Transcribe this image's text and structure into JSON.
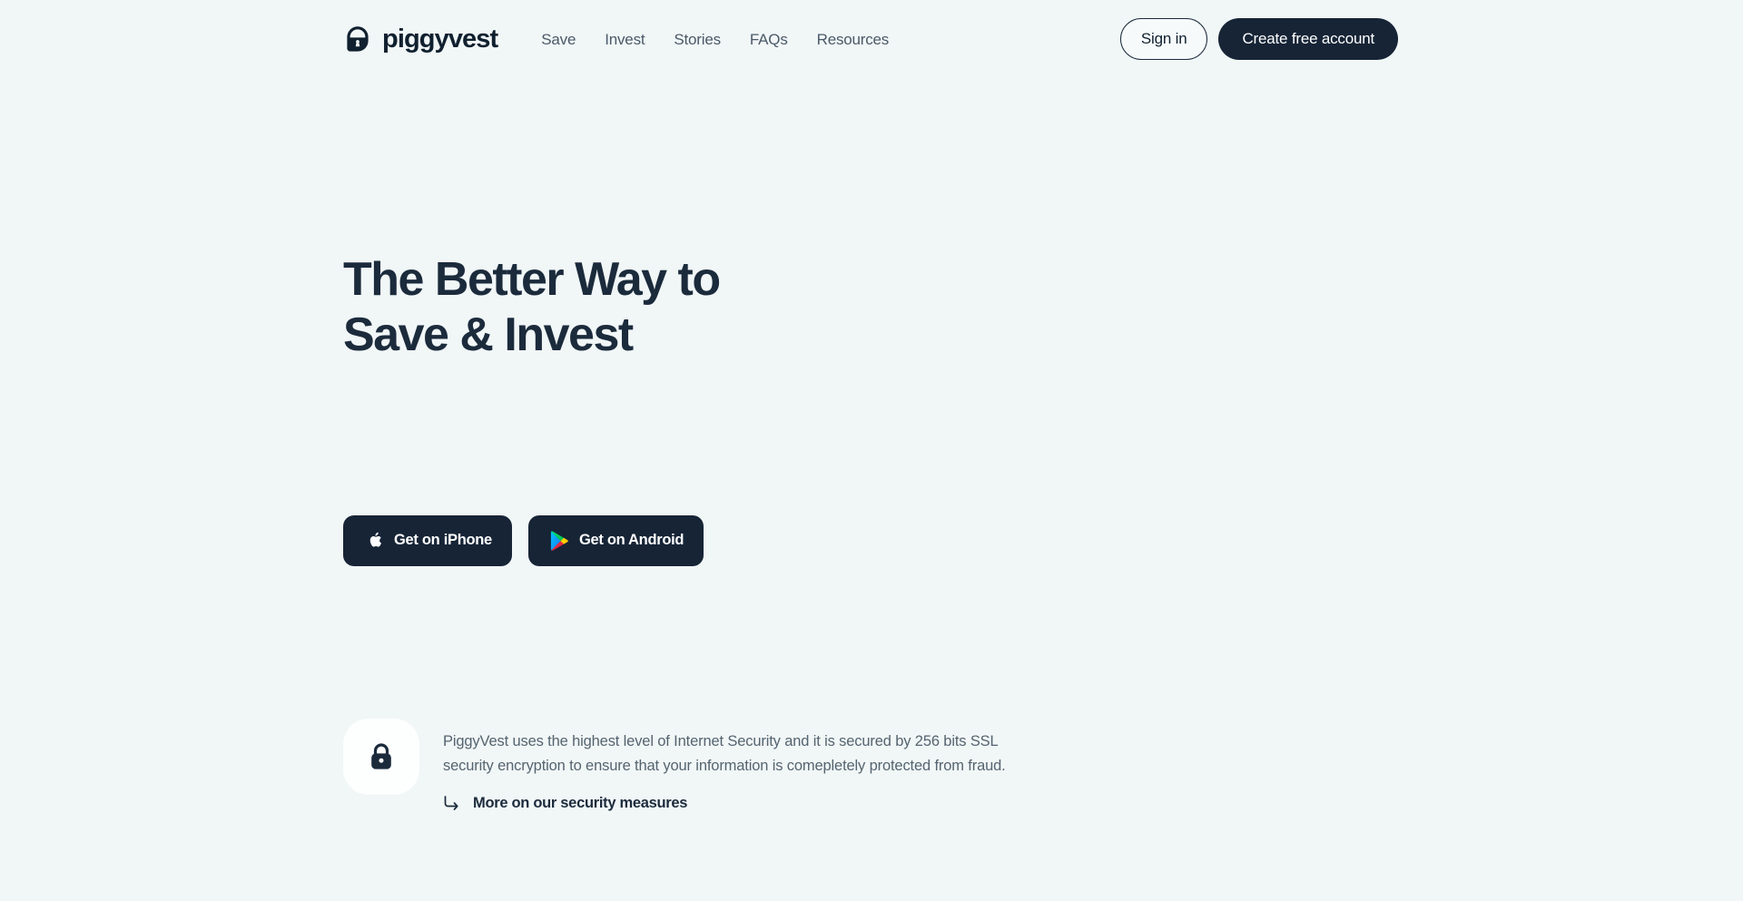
{
  "page": {
    "background_color": "#f1f6f7",
    "text_color": "#1b2b3c",
    "muted_text_color": "#55646f",
    "dark_accent": "#162436"
  },
  "header": {
    "brand": {
      "name": "piggyvest",
      "logo_icon": "padlock-piggybank-icon"
    },
    "nav": [
      {
        "label": "Save"
      },
      {
        "label": "Invest"
      },
      {
        "label": "Stories"
      },
      {
        "label": "FAQs"
      },
      {
        "label": "Resources"
      }
    ],
    "actions": {
      "signin_label": "Sign in",
      "create_account_label": "Create free account"
    }
  },
  "hero": {
    "title_line_1": "The Better Way to",
    "title_line_2": "Save & Invest",
    "subtitle": "",
    "store_buttons": [
      {
        "label": "Get on iPhone",
        "icon": "apple-icon"
      },
      {
        "label": "Get on Android",
        "icon": "google-play-icon"
      }
    ]
  },
  "security": {
    "badge_icon": "padlock-icon",
    "badge_background": "#fdfefe",
    "text": "PiggyVest uses the highest level of Internet Security and it is secured by 256 bits SSL security encryption to ensure that your information is comepletely protected from fraud.",
    "link_label": "More on our security measures",
    "link_icon": "corner-down-right-arrow-icon"
  }
}
